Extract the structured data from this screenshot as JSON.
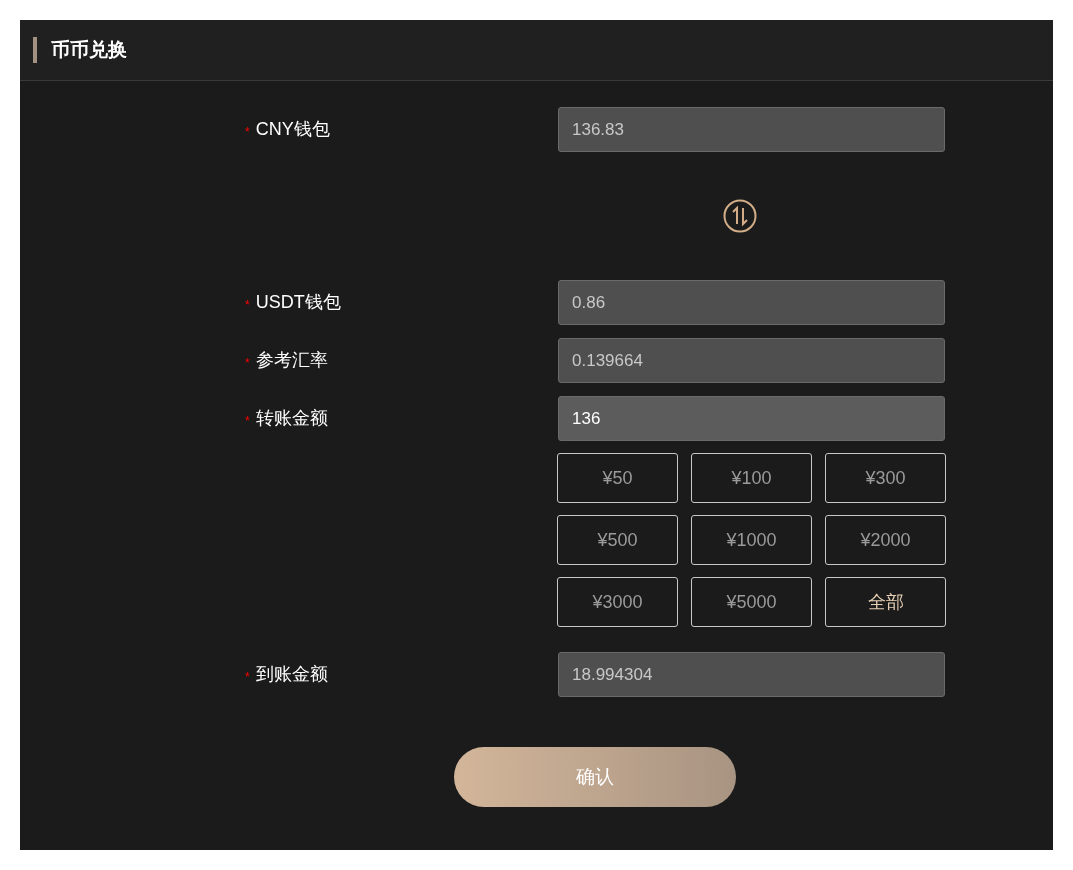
{
  "title": "币币兑换",
  "fields": [
    {
      "label": "CNY钱包",
      "required_mark": "*",
      "value": "136.83",
      "disabled": true
    },
    {
      "label": "USDT钱包",
      "required_mark": "*",
      "value": "0.86",
      "disabled": true
    },
    {
      "label": "参考汇率",
      "required_mark": "*",
      "value": "0.139664",
      "disabled": true
    },
    {
      "label": "转账金额",
      "required_mark": "*",
      "value": "136",
      "disabled": false
    }
  ],
  "amount_buttons": [
    {
      "label": "¥50",
      "kind": "amount"
    },
    {
      "label": "¥100",
      "kind": "amount"
    },
    {
      "label": "¥300",
      "kind": "amount"
    },
    {
      "label": "¥500",
      "kind": "amount"
    },
    {
      "label": "¥1000",
      "kind": "amount"
    },
    {
      "label": "¥2000",
      "kind": "amount"
    },
    {
      "label": "¥3000",
      "kind": "amount"
    },
    {
      "label": "¥5000",
      "kind": "amount"
    },
    {
      "label": "全部",
      "kind": "all"
    }
  ],
  "result_field": {
    "label": "到账金额",
    "required_mark": "*",
    "value": "18.994304",
    "disabled": true
  },
  "confirm_button": "确认"
}
